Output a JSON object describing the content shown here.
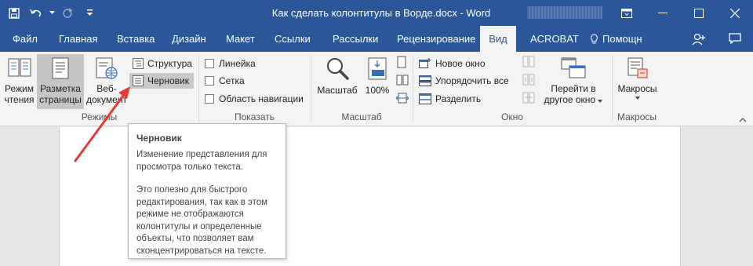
{
  "window": {
    "title": "Как сделать колонтитулы в Ворде.docx - Word"
  },
  "tabs": {
    "file": "Файл",
    "home": "Главная",
    "insert": "Вставка",
    "design": "Дизайн",
    "layout": "Макет",
    "references": "Ссылки",
    "mailings": "Рассылки",
    "review": "Рецензирование",
    "view": "Вид",
    "acrobat": "ACROBAT",
    "tell_me": "Помощн"
  },
  "ribbon": {
    "modes": {
      "label": "Режимы",
      "read_mode_l1": "Режим",
      "read_mode_l2": "чтения",
      "print_layout_l1": "Разметка",
      "print_layout_l2": "страницы",
      "web_layout_l1": "Веб-",
      "web_layout_l2": "документ",
      "outline": "Структура",
      "draft": "Черновик"
    },
    "show": {
      "label": "Показать",
      "ruler": "Линейка",
      "gridlines": "Сетка",
      "nav_pane": "Область навигации"
    },
    "zoom": {
      "label": "Масштаб",
      "zoom_btn": "Масштаб",
      "hundred": "100%"
    },
    "window": {
      "label": "Окно",
      "new_window": "Новое окно",
      "arrange_all": "Упорядочить все",
      "split": "Разделить",
      "switch_l1": "Перейти в",
      "switch_l2": "другое окно"
    },
    "macros": {
      "label": "Макросы",
      "macros_btn": "Макросы"
    }
  },
  "tooltip": {
    "title": "Черновик",
    "paragraph1": "Изменение представления для просмотра только текста.",
    "paragraph2": "Это полезно для быстрого редактирования, так как в этом режиме не отображаются колонтитулы и определенные объекты, что позволяет вам сконцентрироваться на тексте."
  },
  "colors": {
    "titlebar": "#2b579a",
    "ribbon": "#f3f3f3",
    "annotation_arrow": "#e53935"
  }
}
